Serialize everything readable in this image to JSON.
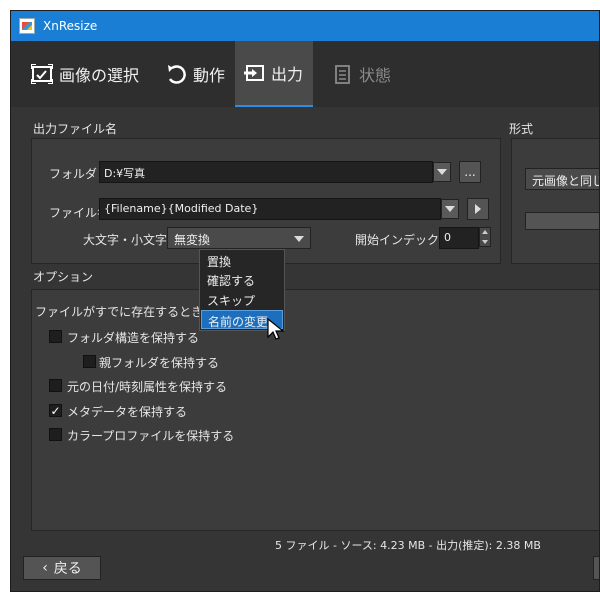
{
  "window": {
    "title": "XnResize"
  },
  "tabs": [
    {
      "label": "画像の選択",
      "icon": "image-select-icon"
    },
    {
      "label": "動作",
      "icon": "undo-arrow-icon"
    },
    {
      "label": "出力",
      "icon": "output-icon"
    },
    {
      "label": "状態",
      "icon": "clipboard-icon"
    }
  ],
  "output_name": {
    "section_label": "出力ファイル名",
    "folder_label": "フォルダ",
    "folder_value": "D:¥写真",
    "browse_label": "...",
    "filename_label": "ファイル名",
    "filename_value": "{Filename}{Modified Date}",
    "case_label": "大文字・小文字",
    "case_value": "無変換",
    "start_index_label": "開始インデックス",
    "start_index_value": "0"
  },
  "format": {
    "section_label": "形式",
    "value": "元画像と同じ"
  },
  "options": {
    "section_label": "オプション",
    "exists_label": "ファイルがすでに存在するとき",
    "menu": [
      "置換",
      "確認する",
      "スキップ",
      "名前の変更"
    ],
    "checkboxes": [
      {
        "label": "フォルダ構造を保持する",
        "checked": false
      },
      {
        "label": "親フォルダを保持する",
        "checked": false
      },
      {
        "label": "元の日付/時刻属性を保持する",
        "checked": false
      },
      {
        "label": "メタデータを保持する",
        "checked": true
      },
      {
        "label": "カラープロファイルを保持する",
        "checked": false
      }
    ]
  },
  "status": "5 ファイル - ソース: 4.23 MB - 出力(推定): 2.38 MB",
  "footer": {
    "back_label": "戻る",
    "back_icon": "chevron-left-icon"
  },
  "colors": {
    "titlebar": "#1a7fd4",
    "accent": "#2b8fe3",
    "selection": "#1d6ebd"
  }
}
